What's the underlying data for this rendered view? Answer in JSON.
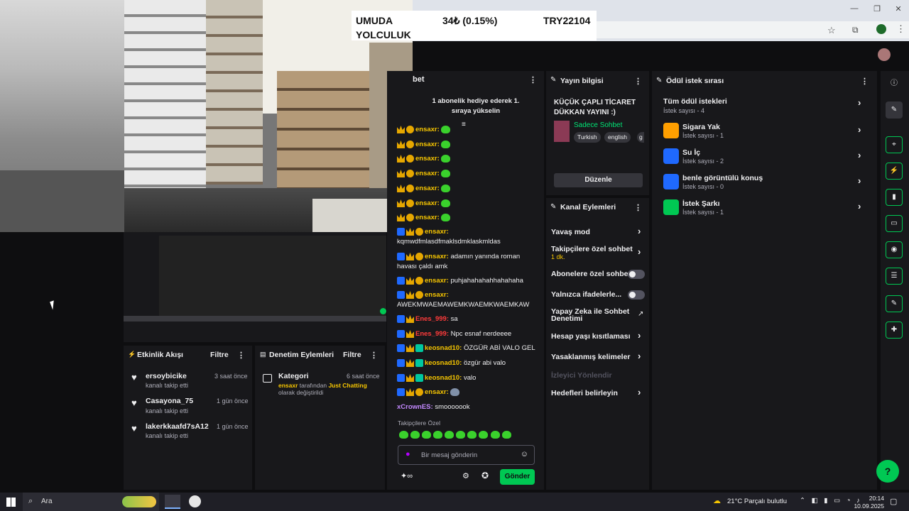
{
  "ticker": {
    "name": "UMUDA YOLCULUK",
    "change": "34₺ (0.15%)",
    "price": "TRY22104"
  },
  "chat": {
    "title": "bet",
    "gift_banner": "1 abonelik hediye ederek 1. sıraya yükselin",
    "messages": [
      {
        "user": "ensaxr",
        "text": ""
      },
      {
        "user": "ensaxr",
        "text": ""
      },
      {
        "user": "ensaxr",
        "text": ""
      },
      {
        "user": "ensaxr",
        "text": ""
      },
      {
        "user": "ensaxr",
        "text": ""
      },
      {
        "user": "ensaxr",
        "text": ""
      },
      {
        "user": "ensaxr",
        "text": ""
      },
      {
        "user": "ensaxr",
        "text": "kqmwdfmlasdfmaklsdmklaskmldas"
      },
      {
        "user": "ensaxr",
        "text": "adamın yanında roman havası çaldı amk"
      },
      {
        "user": "ensaxr",
        "text": "puhjahahahahhahahaha"
      },
      {
        "user": "ensaxr",
        "text": "AWEKMWAEMAWEMKWAEMKWAEMKAW"
      },
      {
        "user": "Enes_999",
        "text": "sa"
      },
      {
        "user": "Enes_999",
        "text": "Npc esnaf nerdeeee"
      },
      {
        "user": "keosnad10",
        "text": "ÖZGÜR ABİ VALO GEL"
      },
      {
        "user": "keosnad10",
        "text": "özgür abi valo"
      },
      {
        "user": "keosnad10",
        "text": "valo"
      },
      {
        "user": "ensaxr",
        "text": ""
      },
      {
        "user": "xCrownES",
        "text": "smooooook"
      }
    ],
    "followers_only": "Takipçilere Özel",
    "input_placeholder": "Bir mesaj gönderin",
    "send_label": "Gönder"
  },
  "stream_info": {
    "title": "Yayın bilgisi",
    "stream_title": "KÜÇÜK ÇAPLI TİCARET DÜKKAN YAYINI :)",
    "category": "Sadece Sohbet",
    "tags": [
      "Turkish",
      "english",
      "g"
    ],
    "edit_label": "Düzenle"
  },
  "channel_actions": {
    "title": "Kanal Eylemleri",
    "items": [
      {
        "label": "Yavaş mod"
      },
      {
        "label": "Takipçilere özel sohbet",
        "sub": "1 dk."
      },
      {
        "label": "Abonelere özel sohbet"
      },
      {
        "label": "Yalnızca ifadelerle..."
      },
      {
        "label": "Yapay Zeka ile Sohbet Denetimi"
      },
      {
        "label": "Hesap yaşı kısıtlaması"
      },
      {
        "label": "Yasaklanmış kelimeler"
      },
      {
        "label": "İzleyici Yönlendir"
      },
      {
        "label": "Hedefleri belirleyin"
      }
    ]
  },
  "rewards": {
    "title": "Ödül istek sırası",
    "all_label": "Tüm ödül istekleri",
    "all_count": "İstek sayısı - 4",
    "items": [
      {
        "label": "Sigara Yak",
        "count": "İstek sayısı - 1",
        "color": "#ff9f00"
      },
      {
        "label": "Su İç",
        "count": "İstek sayısı - 2",
        "color": "#1f69ff"
      },
      {
        "label": "benle görüntülü konuş",
        "count": "İstek sayısı - 0",
        "color": "#1f69ff"
      },
      {
        "label": "İstek Şarkı",
        "count": "İstek sayısı - 1",
        "color": "#00c853"
      }
    ]
  },
  "activity": {
    "title": "Etkinlik Akışı",
    "filter": "Filtre",
    "items": [
      {
        "user": "ersoybicike",
        "action": "kanalı takip etti",
        "time": "3 saat önce"
      },
      {
        "user": "Casayona_75",
        "action": "kanalı takip etti",
        "time": "1 gün önce"
      },
      {
        "user": "lakerkkaafd7sA12",
        "action": "kanalı takip etti",
        "time": "1 gün önce"
      }
    ]
  },
  "moderation": {
    "title": "Denetim Eylemleri",
    "filter": "Filtre",
    "item_title": "Kategori",
    "item_time": "6 saat önce",
    "item_user": "ensaxr",
    "item_mid": "tarafından",
    "item_cat": "Just Chatting",
    "item_end": "olarak değiştirildi"
  },
  "taskbar": {
    "search": "Ara",
    "weather": "21°C  Parçalı bulutlu",
    "time": "20:14",
    "date": "10.09.2025"
  }
}
